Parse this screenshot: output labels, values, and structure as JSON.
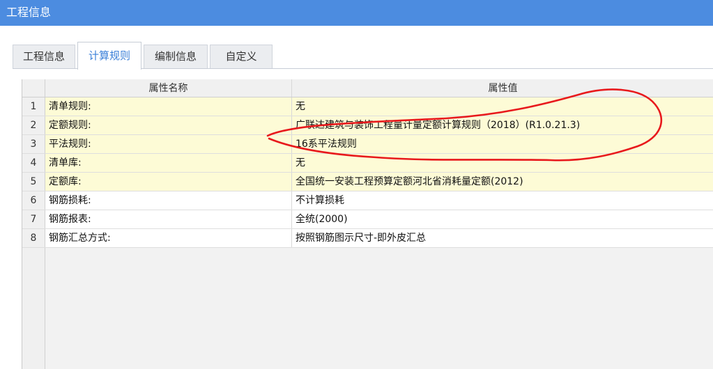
{
  "window": {
    "title": "工程信息"
  },
  "tabs": [
    {
      "label": "工程信息",
      "active": false
    },
    {
      "label": "计算规则",
      "active": true
    },
    {
      "label": "编制信息",
      "active": false
    },
    {
      "label": "自定义",
      "active": false
    }
  ],
  "table": {
    "headers": {
      "name": "属性名称",
      "value": "属性值"
    },
    "rows": [
      {
        "num": "1",
        "name": "清单规则:",
        "value": "无",
        "style": "yellow"
      },
      {
        "num": "2",
        "name": "定额规则:",
        "value": "广联达建筑与装饰工程量计量定额计算规则（2018）(R1.0.21.3)",
        "style": "yellow"
      },
      {
        "num": "3",
        "name": "平法规则:",
        "value": "16系平法规则",
        "style": "yellow"
      },
      {
        "num": "4",
        "name": "清单库:",
        "value": "无",
        "style": "yellow"
      },
      {
        "num": "5",
        "name": "定额库:",
        "value": "全国统一安装工程预算定额河北省消耗量定额(2012)",
        "style": "yellow"
      },
      {
        "num": "6",
        "name": "钢筋损耗:",
        "value": "不计算损耗",
        "style": "white"
      },
      {
        "num": "7",
        "name": "钢筋报表:",
        "value": "全统(2000)",
        "style": "white"
      },
      {
        "num": "8",
        "name": "钢筋汇总方式:",
        "value": "按照钢筋图示尺寸-即外皮汇总",
        "style": "white"
      }
    ]
  },
  "colors": {
    "titlebar": "#4c8ce0",
    "active_tab_text": "#3a7fd8",
    "highlight_row": "#fdfbd6",
    "annotation": "#e8191c"
  }
}
